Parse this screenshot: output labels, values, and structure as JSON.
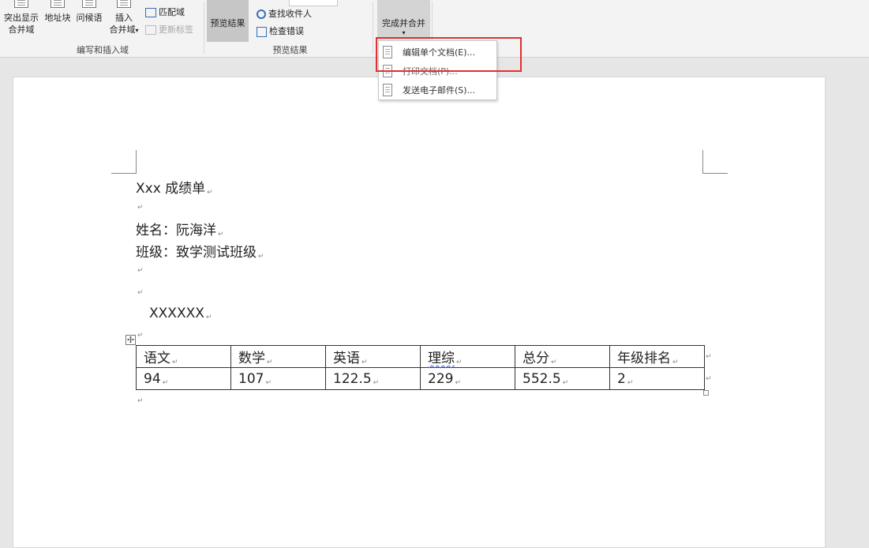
{
  "ribbon": {
    "highlight_merge_fields": "突出显示",
    "highlight_merge_fields_2": "合并域",
    "address_block": "地址块",
    "greeting_line": "问候语",
    "insert_merge_field": "插入",
    "insert_merge_field_2": "合并域",
    "match_fields": "匹配域",
    "update_labels": "更新标签",
    "group_write_insert": "编写和插入域",
    "preview_results": "预览结果",
    "find_recipient": "查找收件人",
    "check_errors": "检查错误",
    "group_preview": "预览结果",
    "finish_merge": "完成并合并",
    "dropdown_arrow": "▾"
  },
  "menu": {
    "items": [
      {
        "label": "编辑单个文档(E)..."
      },
      {
        "label": "打印文档(P)..."
      },
      {
        "label": "发送电子邮件(S)..."
      }
    ]
  },
  "document": {
    "title": "Xxx 成绩单",
    "name_line": "姓名：阮海洋",
    "class_line": "班级：致学测试班级",
    "placeholder": "XXXXXX",
    "paragraph_mark": "↵",
    "table": {
      "headers": [
        "语文",
        "数学",
        "英语",
        "理综",
        "总分",
        "年级排名"
      ],
      "row": [
        "94",
        "107",
        "122.5",
        "229",
        "552.5",
        "2"
      ]
    }
  },
  "colors": {
    "highlight_box": "#e03030",
    "spell_check_underline": "#3b5bdb"
  },
  "icons": {
    "table_move_handle": "✢"
  }
}
